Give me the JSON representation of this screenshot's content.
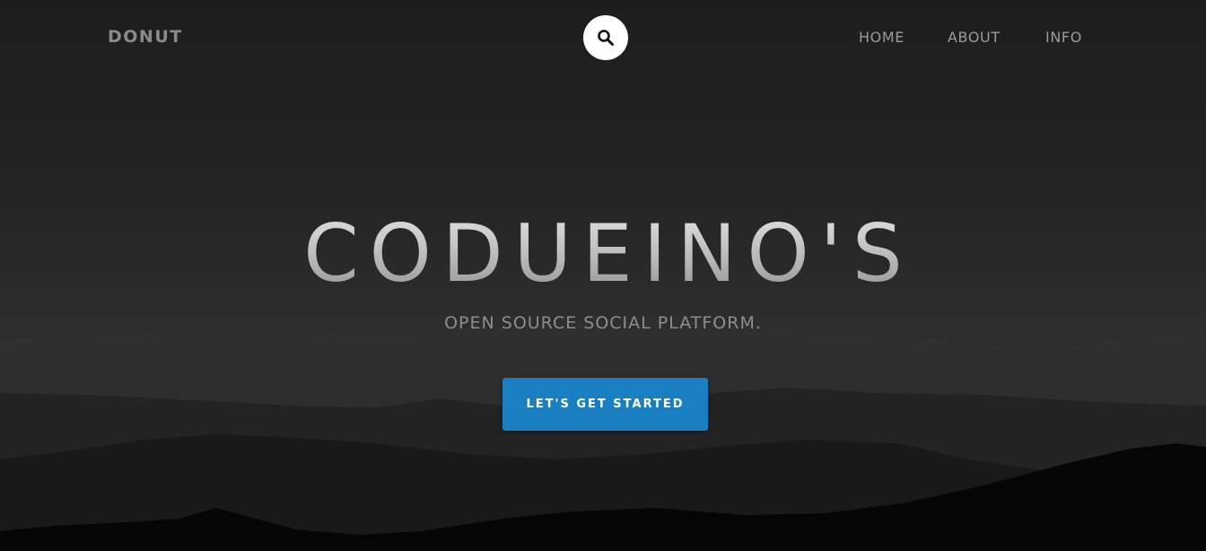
{
  "nav": {
    "brand": "DONUT",
    "search_icon": "search-icon",
    "links": [
      {
        "label": "HOME"
      },
      {
        "label": "ABOUT"
      },
      {
        "label": "INFO"
      }
    ]
  },
  "hero": {
    "title": "CODUEINO'S",
    "subtitle": "OPEN SOURCE SOCIAL PLATFORM.",
    "cta_label": "LET'S GET STARTED"
  },
  "colors": {
    "background": "#1c1c1c",
    "cta_accent": "#1a7fc1",
    "search_circle": "#ffffff",
    "nav_text": "#9a9a9a"
  }
}
